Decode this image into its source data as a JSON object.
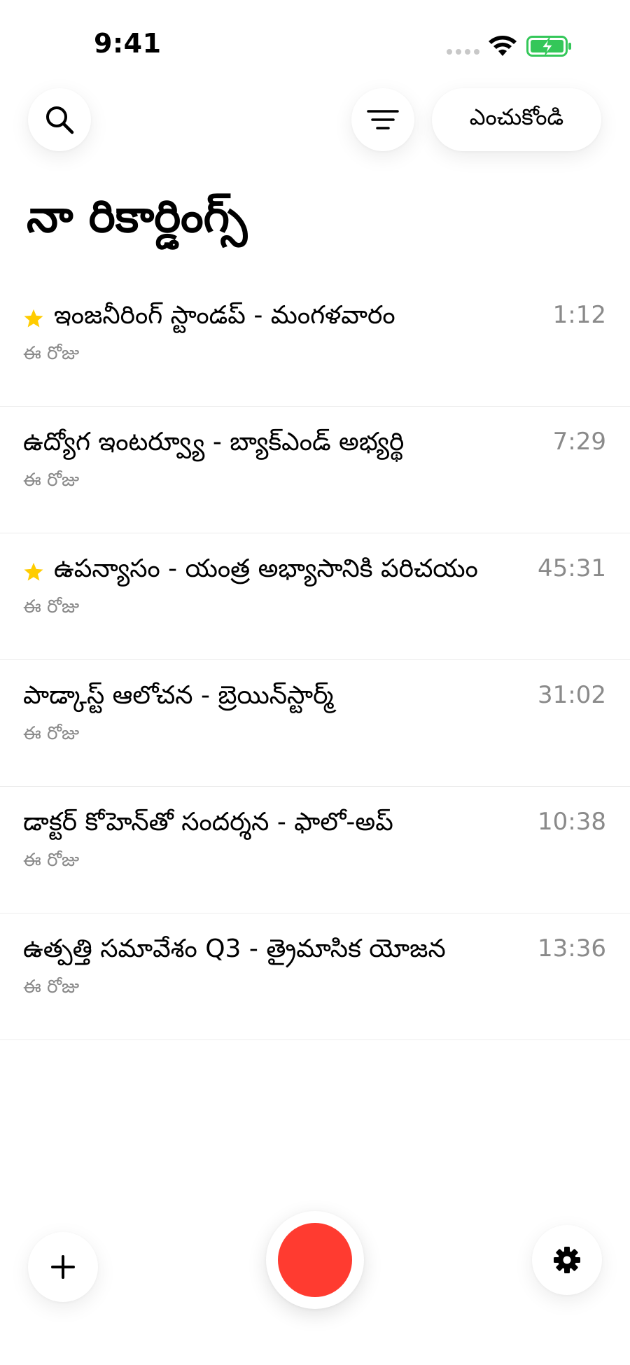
{
  "status_bar": {
    "time": "9:41"
  },
  "toolbar": {
    "search_icon": "search-icon",
    "filter_icon": "filter-icon",
    "select_label": "ఎంచుకోండి"
  },
  "page": {
    "title": "నా రికార్డింగ్స్"
  },
  "recordings": [
    {
      "title": "ఇంజనీరింగ్ స్టాండప్ - మంగళవారం",
      "date": "ఈ రోజు",
      "duration": "1:12",
      "starred": true
    },
    {
      "title": "ఉద్యోగ ఇంటర్వ్యూ - బ్యాక్‌ఎండ్ అభ్యర్థి",
      "date": "ఈ రోజు",
      "duration": "7:29",
      "starred": false
    },
    {
      "title": "ఉపన్యాసం - యంత్ర అభ్యాసానికి పరిచయం",
      "date": "ఈ రోజు",
      "duration": "45:31",
      "starred": true
    },
    {
      "title": "పాడ్కాస్ట్ ఆలోచన - బ్రెయిన్‌స్టార్మ్",
      "date": "ఈ రోజు",
      "duration": "31:02",
      "starred": false
    },
    {
      "title": "డాక్టర్ కోహెన్‌తో సందర్శన - ఫాలో-అప్",
      "date": "ఈ రోజు",
      "duration": "10:38",
      "starred": false
    },
    {
      "title": "ఉత్పత్తి సమావేశం Q3 - త్రైమాసిక యోజన",
      "date": "ఈ రోజు",
      "duration": "13:36",
      "starred": false
    }
  ],
  "bottom_bar": {
    "add_icon": "plus-icon",
    "record_icon": "record-icon",
    "settings_icon": "gear-icon"
  },
  "colors": {
    "record": "#ff3b30",
    "star": "#ffcc00",
    "battery": "#34c759",
    "secondary_text": "#8a8a8a"
  }
}
